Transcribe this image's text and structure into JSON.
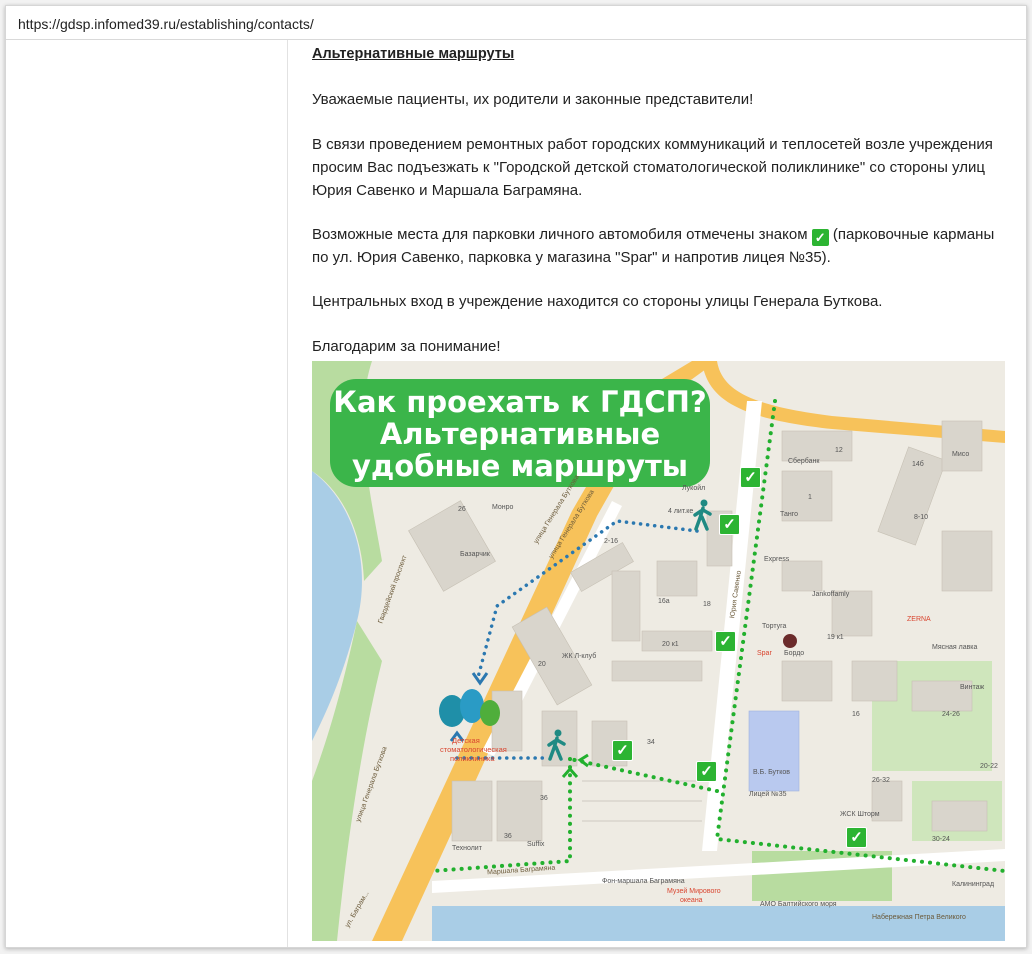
{
  "browser": {
    "url": "https://gdsp.infomed39.ru/establishing/contacts/"
  },
  "article": {
    "heading": "Альтернативные маршруты",
    "greeting": "Уважаемые пациенты, их родители и законные представители!",
    "paragraph_1": "В связи проведением ремонтных работ городских коммуникаций и теплосетей возле учреждения просим Вас подъезжать к \"Городской детской стоматологической поликлинике\" со стороны улиц Юрия Савенко и Маршала Баграмяна.",
    "parking_before": "Возможные места для парковки личного автомобиля отмечены знаком",
    "parking_after": "(парковочные карманы по ул. Юрия Савенко, парковка у магазина \"Spar\" и напротив лицея №35).",
    "entrance": "Центральных вход в учреждение находится со стороны улицы Генерала Буткова.",
    "thanks": "Благодарим за понимание!"
  },
  "map": {
    "banner_lines": [
      "Как проехать к ГДСП?",
      "Альтернативные",
      "удобные маршруты"
    ],
    "colors": {
      "banner": "#3bb54a",
      "green_route": "#22b02e",
      "blue_route": "#2b78b0",
      "check": "#2cb432",
      "road_main": "#f7c25a",
      "water": "#a9cde6",
      "park": "#b8dca0",
      "building": "#d9d5cc",
      "ground": "#eeebe3"
    },
    "labels": {
      "street_butkova_1": "улица Генерала Буткова",
      "street_butkova_2": "улица Генерала Буткова",
      "street_butkova_3": "улица Генерала Буткова",
      "street_bagramyana": "Маршала Баграмяна",
      "street_bagramyana_2": "ул. Баграм...",
      "street_savenko": "Юрия Савенко",
      "street_gvard": "Гвардейский проспект",
      "embankment": "Набережная Петра Великого",
      "clinic_1": "Детская",
      "clinic_2": "стоматологическая",
      "clinic_3": "поликлиника",
      "poi_monroe": "Монро",
      "poi_bazar": "Базарчик",
      "poi_sberbank": "Сбербанк",
      "poi_lukoil": "Лукойл",
      "poi_tango": "Танго",
      "poi_express": "Express",
      "poi_jankoffamly": "Jankoffamly",
      "poi_tortuga": "Тортуга",
      "poi_bordo": "Бордо",
      "poi_zerna": "ZERNA",
      "poi_meat": "Мясная лавка",
      "poi_vintazh": "Винтаж",
      "poi_zhk_shtorm": "ЖСК Шторм",
      "poi_lyceum": "Лицей №35",
      "poi_zhk_klub": "ЖК Л-клуб",
      "poi_tehnolit": "Технолит",
      "poi_suffix": "Suffix",
      "poi_museum_1": "Музей Мирового",
      "poi_museum_2": "океана",
      "poi_amo": "АМО Балтийского моря",
      "poi_kaliningrad": "Калининград",
      "poi_miso": "Мисо",
      "poi_spar": "Spar",
      "poi_vbutkov": "В.Б. Бутков",
      "poi_fish": "Фон-маршала Баграмяна",
      "house_26": "26",
      "house_12": "12",
      "house_14b": "14б",
      "house_1": "1",
      "house_8_10": "8-10",
      "house_2_16": "2-16",
      "house_16a": "16а",
      "house_18": "18",
      "house_20": "20",
      "house_20k1": "20 к1",
      "house_19k1": "19 к1",
      "house_34": "34",
      "house_36": "36",
      "house_36b": "36",
      "house_26_32": "26-32",
      "house_24_26": "24-26",
      "house_20_22": "20-22",
      "house_30_24": "30-24",
      "house_16": "16",
      "house_4": "4 лит.ке"
    }
  }
}
